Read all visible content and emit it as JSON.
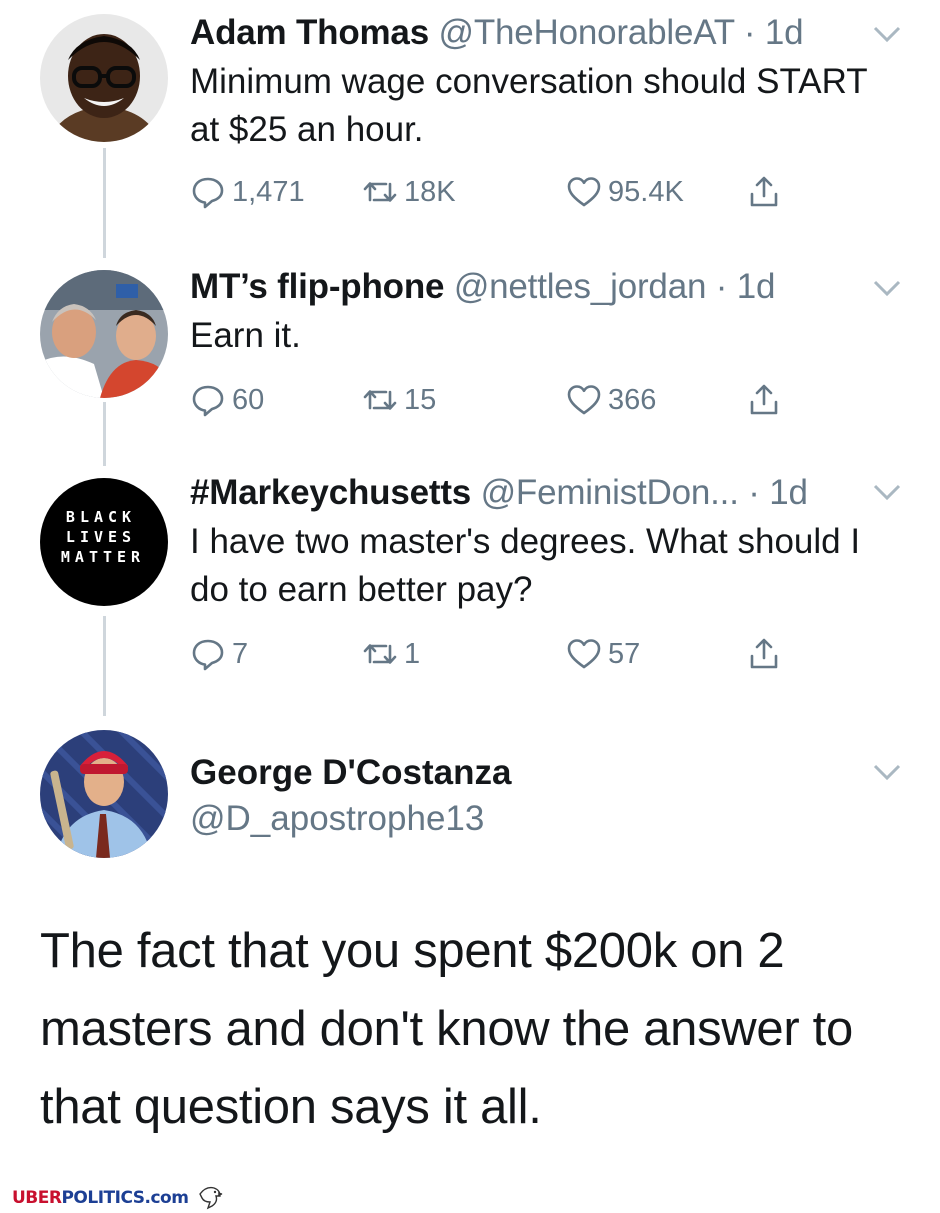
{
  "tweets": [
    {
      "name": "Adam Thomas",
      "handle": "@TheHonorableAT",
      "time": "· 1d",
      "text": "Minimum wage conversation should START at $25 an hour.",
      "replies": "1,471",
      "retweets": "18K",
      "likes": "95.4K"
    },
    {
      "name": "MT’s flip-phone",
      "handle": "@nettles_jordan",
      "time": "· 1d",
      "text": "Earn it.",
      "replies": "60",
      "retweets": "15",
      "likes": "366"
    },
    {
      "name": "#Markeychusetts",
      "handle": "@FeministDon...",
      "time": "· 1d",
      "text": "I have two master's degrees. What should I do to earn better pay?",
      "replies": "7",
      "retweets": "1",
      "likes": "57",
      "avatar_text": "BLACK LIVES MATTER"
    }
  ],
  "reply_tweet": {
    "name": "George D'Costanza",
    "handle": "@D_apostrophe13",
    "text": "The fact that you spent $200k on 2 masters and don't know the answer to that question says it all."
  },
  "watermark": {
    "part1": "UBER",
    "part2": "POLITICS",
    "part3": ".com"
  },
  "icons": [
    "reply-icon",
    "retweet-icon",
    "like-icon",
    "share-icon",
    "chevron-down-icon",
    "eagle-icon"
  ],
  "colors": {
    "text": "#14171a",
    "secondary": "#657786",
    "thread_line": "#cfd6dc",
    "watermark_red": "#c8102e",
    "watermark_blue": "#1c3f94"
  }
}
